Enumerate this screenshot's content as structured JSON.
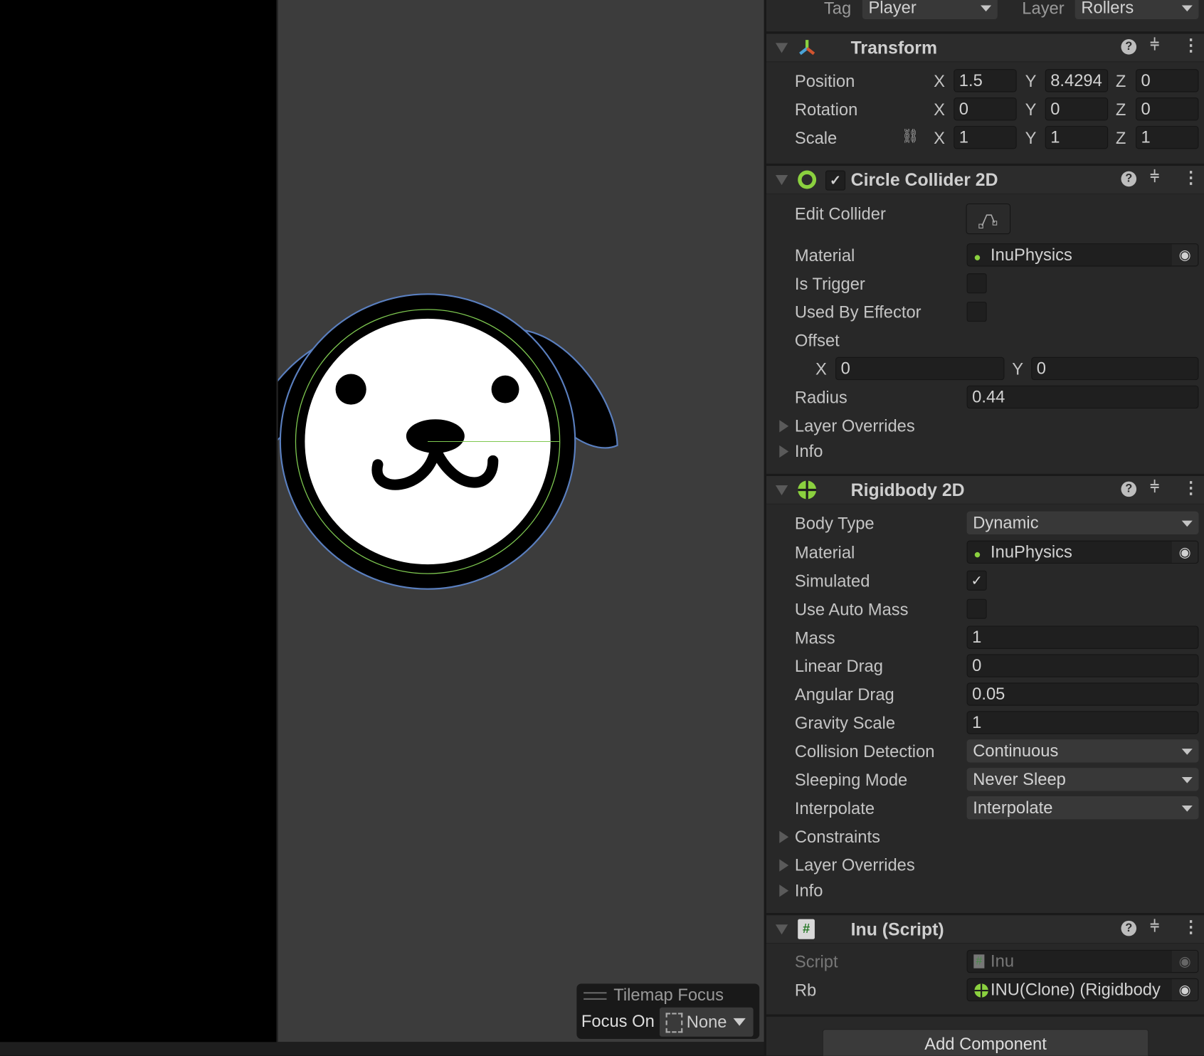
{
  "header": {
    "tag_label": "Tag",
    "tag_value": "Player",
    "layer_label": "Layer",
    "layer_value": "Rollers"
  },
  "transform": {
    "title": "Transform",
    "rows": [
      {
        "label": "Position",
        "x": "1.5",
        "y": "8.4294",
        "z": "0"
      },
      {
        "label": "Rotation",
        "x": "0",
        "y": "0",
        "z": "0"
      },
      {
        "label": "Scale",
        "x": "1",
        "y": "1",
        "z": "1"
      }
    ],
    "axes": {
      "x": "X",
      "y": "Y",
      "z": "Z"
    }
  },
  "circle_collider": {
    "title": "Circle Collider 2D",
    "enabled": true,
    "edit_collider": "Edit Collider",
    "material_label": "Material",
    "material": "InuPhysics",
    "is_trigger": "Is Trigger",
    "used_by_effector": "Used By Effector",
    "offset": "Offset",
    "offset_x": "0",
    "offset_y": "0",
    "radius_label": "Radius",
    "radius": "0.44",
    "layer_overrides": "Layer Overrides",
    "info": "Info"
  },
  "rigidbody": {
    "title": "Rigidbody 2D",
    "body_type_label": "Body Type",
    "body_type": "Dynamic",
    "material_label": "Material",
    "material": "InuPhysics",
    "simulated": "Simulated",
    "use_auto_mass": "Use Auto Mass",
    "mass_label": "Mass",
    "mass": "1",
    "linear_drag_label": "Linear Drag",
    "linear_drag": "0",
    "angular_drag_label": "Angular Drag",
    "angular_drag": "0.05",
    "gravity_scale_label": "Gravity Scale",
    "gravity_scale": "1",
    "collision_label": "Collision Detection",
    "collision": "Continuous",
    "sleeping_label": "Sleeping Mode",
    "sleeping": "Never Sleep",
    "interpolate_label": "Interpolate",
    "interpolate": "Interpolate",
    "constraints": "Constraints",
    "layer_overrides": "Layer Overrides",
    "info": "Info"
  },
  "script": {
    "title": "Inu (Script)",
    "script_label": "Script",
    "script": "Inu",
    "rb_label": "Rb",
    "rb": "INU(Clone) (Rigidbody"
  },
  "add_component": "Add Component",
  "tilemap_focus": {
    "title": "Tilemap Focus",
    "focus_label": "Focus On",
    "focus_value": "None"
  },
  "colors": {
    "collider": "#7ec850",
    "selection": "#5a7fbf",
    "accent": "#8bd13f"
  }
}
